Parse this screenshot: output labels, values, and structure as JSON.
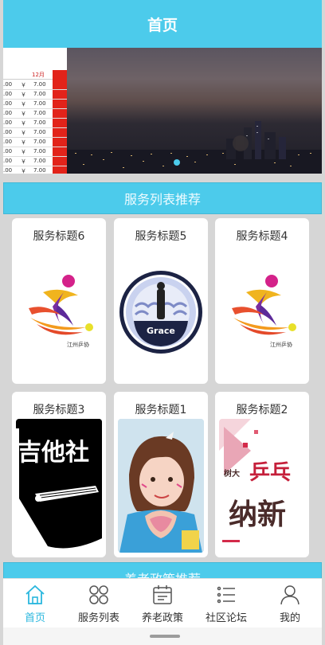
{
  "header": {
    "title": "首页"
  },
  "banner": {
    "sheet_month": "12月",
    "sheet_rows": [
      {
        "a": ".00",
        "cur": "￥",
        "v": "7.00"
      },
      {
        "a": ".00",
        "cur": "￥",
        "v": "7.00"
      },
      {
        "a": ".00",
        "cur": "￥",
        "v": "7.00"
      },
      {
        "a": ".00",
        "cur": "￥",
        "v": "7.00"
      },
      {
        "a": ".00",
        "cur": "￥",
        "v": "7.00"
      },
      {
        "a": ".00",
        "cur": "￥",
        "v": "7.00"
      },
      {
        "a": ".00",
        "cur": "￥",
        "v": "7.00"
      },
      {
        "a": ".00",
        "cur": "￥",
        "v": "7.00"
      },
      {
        "a": ".00",
        "cur": "￥",
        "v": "7.00"
      },
      {
        "a": ".00",
        "cur": "￥",
        "v": "7.00"
      }
    ]
  },
  "sections": {
    "services": "服务列表推荐",
    "policy": "养老政策推荐"
  },
  "services": [
    {
      "title": "服务标题6",
      "image": "sports-logo-icon"
    },
    {
      "title": "服务标题5",
      "image": "grace-badge-icon"
    },
    {
      "title": "服务标题4",
      "image": "sports-logo-icon"
    },
    {
      "title": "服务标题3",
      "image": "guitar-club-logo-icon"
    },
    {
      "title": "服务标题1",
      "image": "girl-photo"
    },
    {
      "title": "服务标题2",
      "image": "pingpong-poster"
    }
  ],
  "images": {
    "grace_text": "Grace",
    "guitar_text": "吉他社",
    "poster_small": "树大",
    "poster_top": "乒乓",
    "poster_big": "纳新",
    "sports_caption": "江州乒协"
  },
  "tabbar": {
    "items": [
      {
        "label": "首页",
        "icon": "home-icon",
        "active": true
      },
      {
        "label": "服务列表",
        "icon": "grid-icon",
        "active": false
      },
      {
        "label": "养老政策",
        "icon": "calendar-icon",
        "active": false
      },
      {
        "label": "社区论坛",
        "icon": "list-icon",
        "active": false
      },
      {
        "label": "我的",
        "icon": "user-icon",
        "active": false
      }
    ]
  },
  "colors": {
    "accent": "#4ccbeb",
    "active_tab": "#2ab7de"
  }
}
